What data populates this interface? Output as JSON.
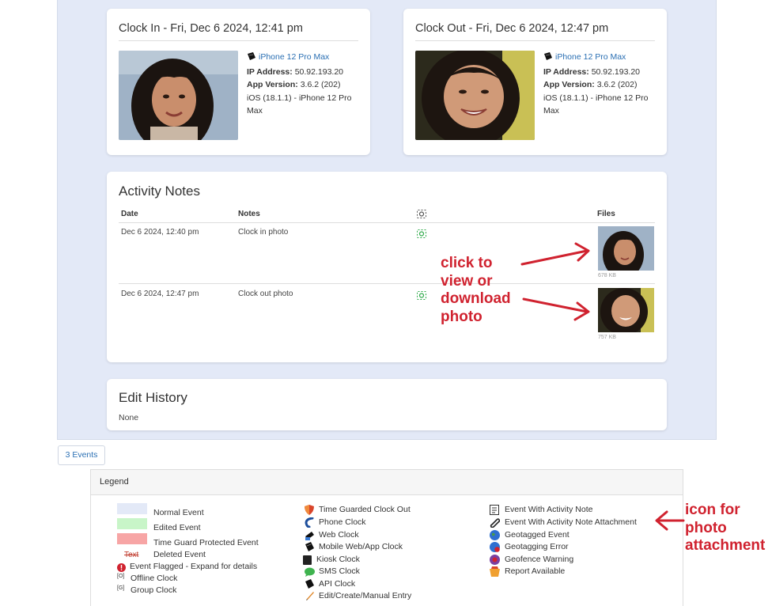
{
  "clock_in": {
    "title": "Clock In - Fri, Dec 6 2024, 12:41 pm",
    "device": "iPhone 12 Pro Max",
    "ip_label": "IP Address:",
    "ip": "50.92.193.20",
    "app_label": "App Version:",
    "app": "3.6.2 (202)",
    "os": "iOS (18.1.1) - iPhone 12 Pro Max"
  },
  "clock_out": {
    "title": "Clock Out - Fri, Dec 6 2024, 12:47 pm",
    "device": "iPhone 12 Pro Max",
    "ip_label": "IP Address:",
    "ip": "50.92.193.20",
    "app_label": "App Version:",
    "app": "3.6.2 (202)",
    "os": "iOS (18.1.1) - iPhone 12 Pro Max"
  },
  "activity_notes": {
    "title": "Activity Notes",
    "headers": {
      "date": "Date",
      "notes": "Notes",
      "files": "Files"
    },
    "rows": [
      {
        "date": "Dec 6 2024, 12:40 pm",
        "note": "Clock in photo",
        "file_size": "678 KB"
      },
      {
        "date": "Dec 6 2024, 12:47 pm",
        "note": "Clock out photo",
        "file_size": "757 KB"
      }
    ]
  },
  "edit_history": {
    "title": "Edit History",
    "value": "None"
  },
  "events_button": "3 Events",
  "legend": {
    "title": "Legend",
    "col1": [
      {
        "label": "Normal Event",
        "color": "#e3e9f7"
      },
      {
        "label": "Edited Event",
        "color": "#c8f5c8"
      },
      {
        "label": "Time Guard Protected Event",
        "color": "#f7a5a5"
      },
      {
        "mark": "Text",
        "label": "Deleted Event"
      },
      {
        "label": "Event Flagged - Expand for details"
      },
      {
        "mark": "[O]",
        "label": "Offline Clock"
      },
      {
        "mark": "[G]",
        "label": "Group Clock"
      }
    ],
    "col2": [
      {
        "label": "Time Guarded Clock Out",
        "icon": "shield-icon"
      },
      {
        "label": "Phone Clock",
        "icon": "phone-icon"
      },
      {
        "label": "Web Clock",
        "icon": "web-icon"
      },
      {
        "label": "Mobile Web/App Clock",
        "icon": "mobile-icon"
      },
      {
        "label": "Kiosk Clock",
        "icon": "kiosk-icon"
      },
      {
        "label": "SMS Clock",
        "icon": "sms-icon"
      },
      {
        "label": "API Clock",
        "icon": "api-icon"
      },
      {
        "label": "Edit/Create/Manual Entry",
        "icon": "pencil-icon"
      }
    ],
    "col3": [
      {
        "label": "Event With Activity Note",
        "icon": "note-icon"
      },
      {
        "label": "Event With Activity Note Attachment",
        "icon": "paperclip-icon"
      },
      {
        "label": "Geotagged Event",
        "icon": "globe-icon"
      },
      {
        "label": "Geotagging Error",
        "icon": "globe-error-icon"
      },
      {
        "label": "Geofence Warning",
        "icon": "geofence-icon"
      },
      {
        "label": "Report Available",
        "icon": "report-icon"
      }
    ]
  },
  "annotations": {
    "photo_lines": [
      "click to",
      "view or",
      "download",
      "photo"
    ],
    "icon_lines": [
      "icon for",
      "photo",
      "attachment"
    ]
  },
  "colors": {
    "accent_link": "#2a6fb3",
    "annotation_red": "#d0222f",
    "event_bg": "#e3e9f7"
  }
}
